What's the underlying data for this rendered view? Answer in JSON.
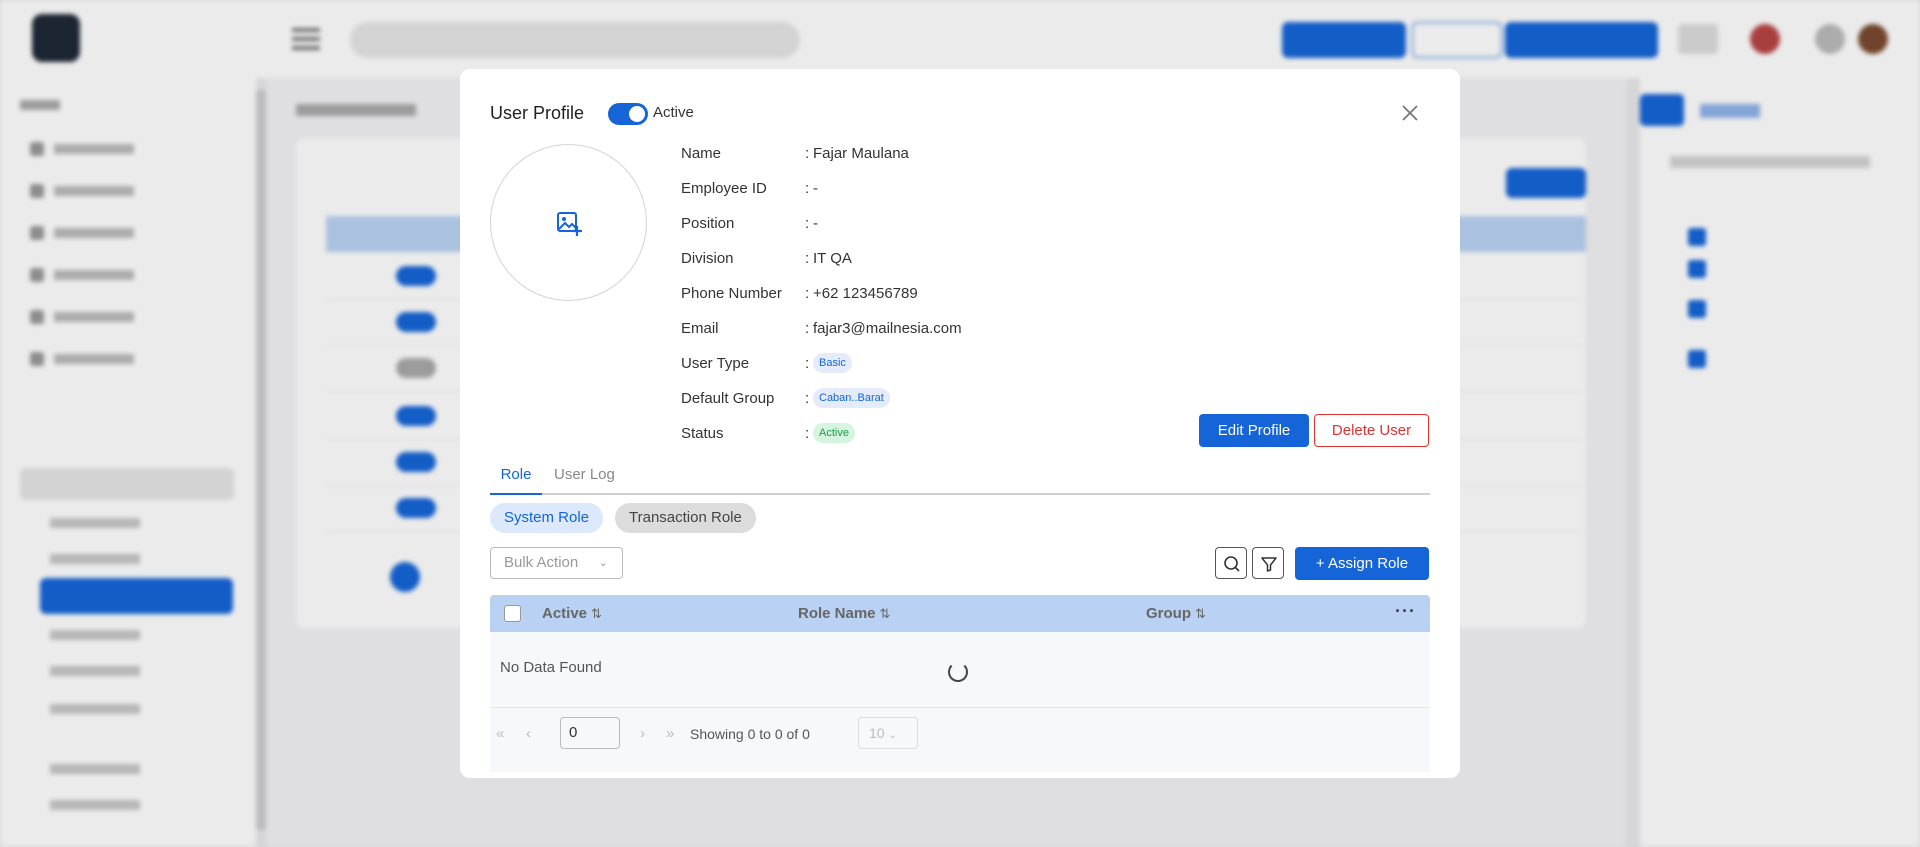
{
  "modal": {
    "title": "User Profile",
    "status_toggle_label": "Active",
    "status_toggle_on": true,
    "fields": [
      {
        "label": "Name",
        "value": "Fajar Maulana",
        "type": "text"
      },
      {
        "label": "Employee ID",
        "value": "-",
        "type": "text"
      },
      {
        "label": "Position",
        "value": "-",
        "type": "text"
      },
      {
        "label": "Division",
        "value": "IT QA",
        "type": "text"
      },
      {
        "label": "Phone Number",
        "value": "+62 123456789",
        "type": "text"
      },
      {
        "label": "Email",
        "value": "fajar3@mailnesia.com",
        "type": "text"
      },
      {
        "label": "User Type",
        "value": "Basic",
        "type": "pill-blue"
      },
      {
        "label": "Default Group",
        "value": "Caban..Barat",
        "type": "pill-blue"
      },
      {
        "label": "Status",
        "value": "Active",
        "type": "pill-green"
      }
    ],
    "edit_label": "Edit Profile",
    "delete_label": "Delete User",
    "tabs": [
      {
        "label": "Role",
        "active": true
      },
      {
        "label": "User Log",
        "active": false
      }
    ],
    "subtabs": [
      {
        "label": "System Role",
        "active": true
      },
      {
        "label": "Transaction Role",
        "active": false
      }
    ],
    "bulk_action_label": "Bulk Action",
    "assign_role_label": "Assign Role",
    "table": {
      "columns": [
        "Active",
        "Role Name",
        "Group"
      ],
      "empty_text": "No Data Found"
    },
    "pagination": {
      "page": "0",
      "showing_text": "Showing 0 to 0 of 0",
      "page_size": "10"
    }
  },
  "colors": {
    "primary": "#1565d8",
    "danger": "#e03131",
    "success": "#1a9a4b",
    "table_header": "#b9d2f4"
  },
  "icons": [
    "image-add-icon",
    "close-icon",
    "search-icon",
    "filter-icon",
    "plus-icon",
    "chevron-down-icon",
    "sort-icon",
    "more-icon",
    "spinner-icon"
  ]
}
